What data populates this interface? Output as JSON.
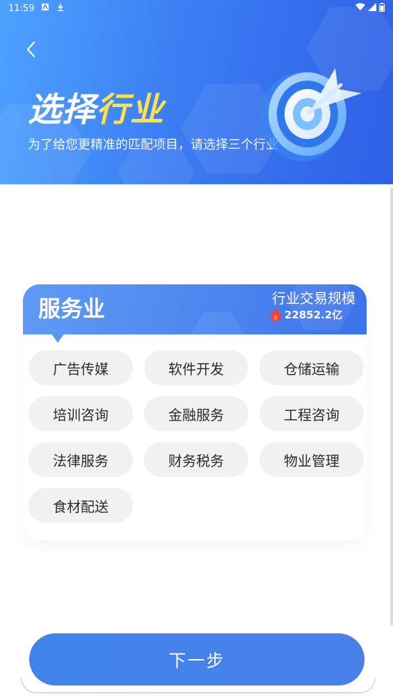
{
  "status_bar": {
    "time": "11:59"
  },
  "header": {
    "title_white": "选择",
    "title_yellow": "行业",
    "subtitle": "为了给您更精准的匹配项目，请选择三个行业"
  },
  "card": {
    "title": "服务业",
    "scale_label": "行业交易规模",
    "scale_value": "22852.2亿",
    "tags": [
      "广告传媒",
      "软件开发",
      "仓储运输",
      "培训咨询",
      "金融服务",
      "工程咨询",
      "法律服务",
      "财务税务",
      "物业管理",
      "食材配送"
    ]
  },
  "next_button": {
    "label": "下一步"
  },
  "colors": {
    "accent": "#3f84ea",
    "title_highlight": "#ffe24a",
    "tag_bg": "#f1f1f2"
  },
  "icons": [
    "back-icon",
    "target-icon",
    "fire-icon",
    "wifi-icon",
    "signal-icon",
    "battery-icon",
    "download-icon",
    "notification-icon"
  ]
}
